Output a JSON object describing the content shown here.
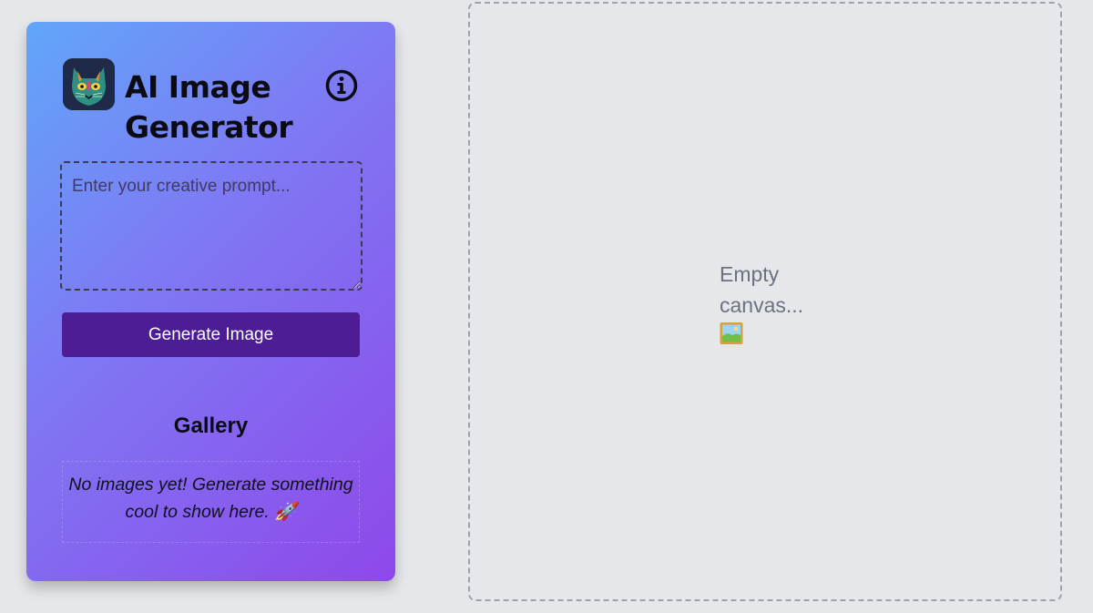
{
  "sidebar": {
    "logo_icon": "cat-logo-icon",
    "title": "AI Image Generator",
    "info_icon": "info-circle-icon",
    "prompt": {
      "placeholder": "Enter your creative prompt...",
      "value": ""
    },
    "generate_label": "Generate Image",
    "gallery_title": "Gallery",
    "gallery_empty": "No images yet! Generate something cool to show here. 🚀"
  },
  "canvas": {
    "empty_text": "Empty canvas...",
    "empty_icon": "framed-picture-icon"
  },
  "colors": {
    "page_bg": "#e6e7eb",
    "gradient_start": "#61a6fb",
    "gradient_end": "#8e48ea",
    "button": "#4c1d95",
    "canvas_text": "#6b7280"
  }
}
